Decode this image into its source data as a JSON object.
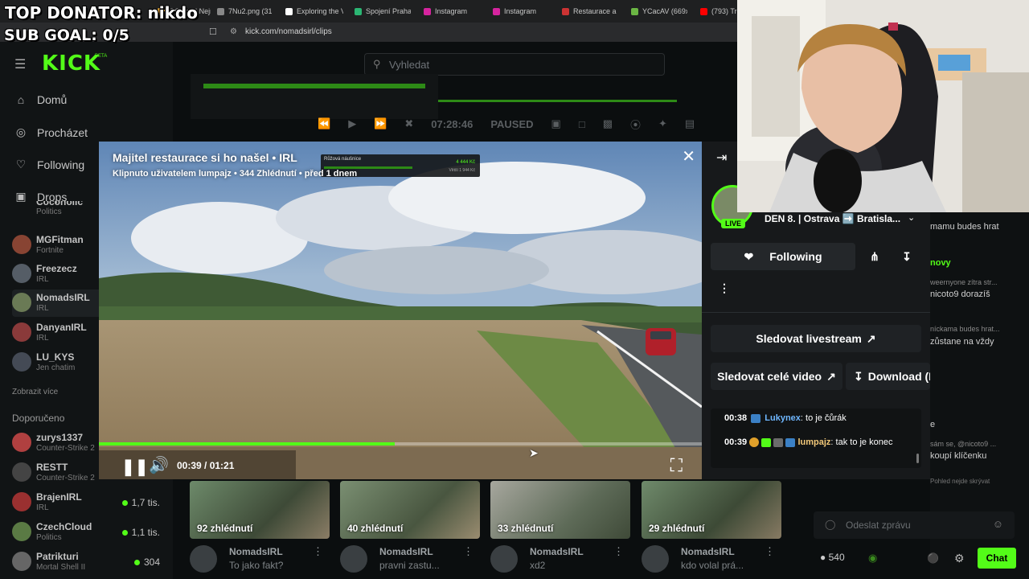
{
  "overlay": {
    "top_donator": "TOP DONATOR: nikdo",
    "sub_goal": "SUB GOAL: 0/5"
  },
  "browser": {
    "tabs": [
      {
        "label": "GQ | cz | Nejny",
        "color": "#e0a030"
      },
      {
        "label": "7Nu2.png (310",
        "color": "#888"
      },
      {
        "label": "Exploring the V",
        "color": "#fff"
      },
      {
        "label": "Spojení Praha",
        "color": "#2bb673"
      },
      {
        "label": "Instagram",
        "color": "#d6249f"
      },
      {
        "label": "Instagram",
        "color": "#d6249f"
      },
      {
        "label": "Restaurace a p",
        "color": "#c33"
      },
      {
        "label": "YCacAV (669x4",
        "color": "#6bb644"
      },
      {
        "label": "(793) Tre",
        "color": "#ff0000"
      }
    ],
    "url": "kick.com/nomadsirl/clips"
  },
  "kick": {
    "logo": "KICK",
    "logo_beta": "BETA",
    "search_placeholder": "Vyhledat",
    "nav": [
      {
        "label": "Domů",
        "icon": "home-icon"
      },
      {
        "label": "Procházet",
        "icon": "compass-icon"
      },
      {
        "label": "Following",
        "icon": "heart-icon"
      },
      {
        "label": "Drops",
        "icon": "gift-icon"
      }
    ],
    "following_channels": [
      {
        "name": "Cocoholic",
        "category": "Politics",
        "color": "#7a5c3c"
      },
      {
        "name": "MGFitman",
        "category": "Fortnite",
        "color": "#884433"
      },
      {
        "name": "Freezecz",
        "category": "IRL",
        "color": "#555d66"
      },
      {
        "name": "NomadsIRL",
        "category": "IRL",
        "color": "#6a7a55"
      },
      {
        "name": "DanyanIRL",
        "category": "IRL",
        "color": "#8a3a3a"
      },
      {
        "name": "LU_KYS",
        "category": "Jen chatim",
        "color": "#444a55"
      }
    ],
    "show_more": "Zobrazit více",
    "recommended_header": "Doporučeno",
    "recommended_channels": [
      {
        "name": "zurys1337",
        "category": "Counter-Strike 2",
        "viewers": "",
        "color": "#b04040"
      },
      {
        "name": "RESTT",
        "category": "Counter-Strike 2",
        "viewers": "",
        "color": "#444"
      },
      {
        "name": "BrajenIRL",
        "category": "IRL",
        "viewers": "1,7 tis.",
        "color": "#9a3030"
      },
      {
        "name": "CzechCloud",
        "category": "Politics",
        "viewers": "1,1 tis.",
        "color": "#5a7a44"
      },
      {
        "name": "Patrikturi",
        "category": "Mortal Shell II",
        "viewers": "304",
        "color": "#666"
      }
    ]
  },
  "player_controls": {
    "time": "07:28:46",
    "status": "PAUSED"
  },
  "clip": {
    "title": "Majitel restaurace si ho našel • IRL",
    "subtitle": "Klipnuto uživatelem lumpajz • 344 Zhlédnutí • před 1 dnem",
    "time_display": "00:39 / 01:21",
    "progress": 0.49,
    "stream_title": "DEN 8. | Ostrava ➡️ Bratisla...",
    "live_badge": "LIVE",
    "following_label": "Following",
    "watch_livestream": "Sledovat livestream",
    "watch_full_video": "Sledovat celé video",
    "download": "Download (I",
    "chat": [
      {
        "time": "00:38",
        "user": "Lukynex",
        "user_color": "#6fb7ff",
        "text": "to je čůrák"
      },
      {
        "time": "00:39",
        "user": "lumpajz",
        "user_color": "#f2c879",
        "text": "tak to je konec"
      }
    ]
  },
  "right_chat": {
    "lines": [
      "mamu budes hrat",
      "novy",
      "weernyone zítra str...",
      "nicoto9 dorazíš",
      "níckama budes hrat...",
      "zůstane na vždy",
      "e",
      "sám se, @nicoto9 ...",
      "koupí klíčenku"
    ],
    "input_placeholder": "Odeslat zprávu",
    "viewers": "540",
    "chat_button": "Chat",
    "pinned_label": "Pohled nejde skrývat"
  },
  "thumbnails": [
    {
      "views": "92 zhlédnutí",
      "channel": "NomadsIRL",
      "title": "To jako fakt?"
    },
    {
      "views": "40 zhlédnutí",
      "channel": "NomadsIRL",
      "title": "pravni zastu..."
    },
    {
      "views": "33 zhlédnutí",
      "channel": "NomadsIRL",
      "title": "xd2"
    },
    {
      "views": "29 zhlédnutí",
      "channel": "NomadsIRL",
      "title": "kdo volal prá..."
    }
  ],
  "mini_overlay": {
    "label": "Růžová náušnice",
    "value": "4 444 Kč",
    "sub": "Větší 1 944 Kč"
  }
}
